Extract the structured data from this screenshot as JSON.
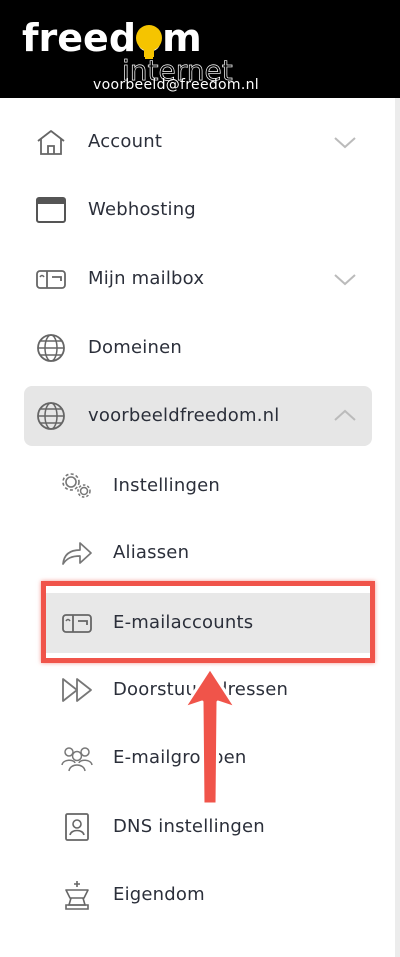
{
  "header": {
    "logo_text_main": "freedom",
    "logo_text_sub": "internet",
    "account_email": "voorbeeld@freedom.nl",
    "background": "#000000",
    "logo_accent_color": "#f5c400"
  },
  "sidebar": {
    "items": [
      {
        "label": "Account",
        "icon": "home-icon",
        "chevron": "chevron-down-icon"
      },
      {
        "label": "Webhosting",
        "icon": "browser-window-icon"
      },
      {
        "label": "Mijn mailbox",
        "icon": "mailbox-icon",
        "chevron": "chevron-down-icon"
      },
      {
        "label": "Domeinen",
        "icon": "globe-icon"
      },
      {
        "label": "voorbeeldfreedom.nl",
        "icon": "globe-icon",
        "chevron": "chevron-up-icon",
        "expanded": true
      }
    ],
    "subitems": [
      {
        "label": "Instellingen",
        "icon": "gears-icon"
      },
      {
        "label": "Aliassen",
        "icon": "forward-arrow-icon"
      },
      {
        "label": "E-mailaccounts",
        "icon": "mailbox-icon",
        "active": true
      },
      {
        "label": "Doorstuuradressen",
        "icon": "fast-forward-icon"
      },
      {
        "label": "E-mailgroepen",
        "icon": "group-icon"
      },
      {
        "label": "DNS instellingen",
        "icon": "contact-card-icon"
      },
      {
        "label": "Eigendom",
        "icon": "king-chess-icon"
      }
    ]
  },
  "annotation": {
    "highlight_color": "#f0544a",
    "arrow_color": "#f0544a"
  }
}
